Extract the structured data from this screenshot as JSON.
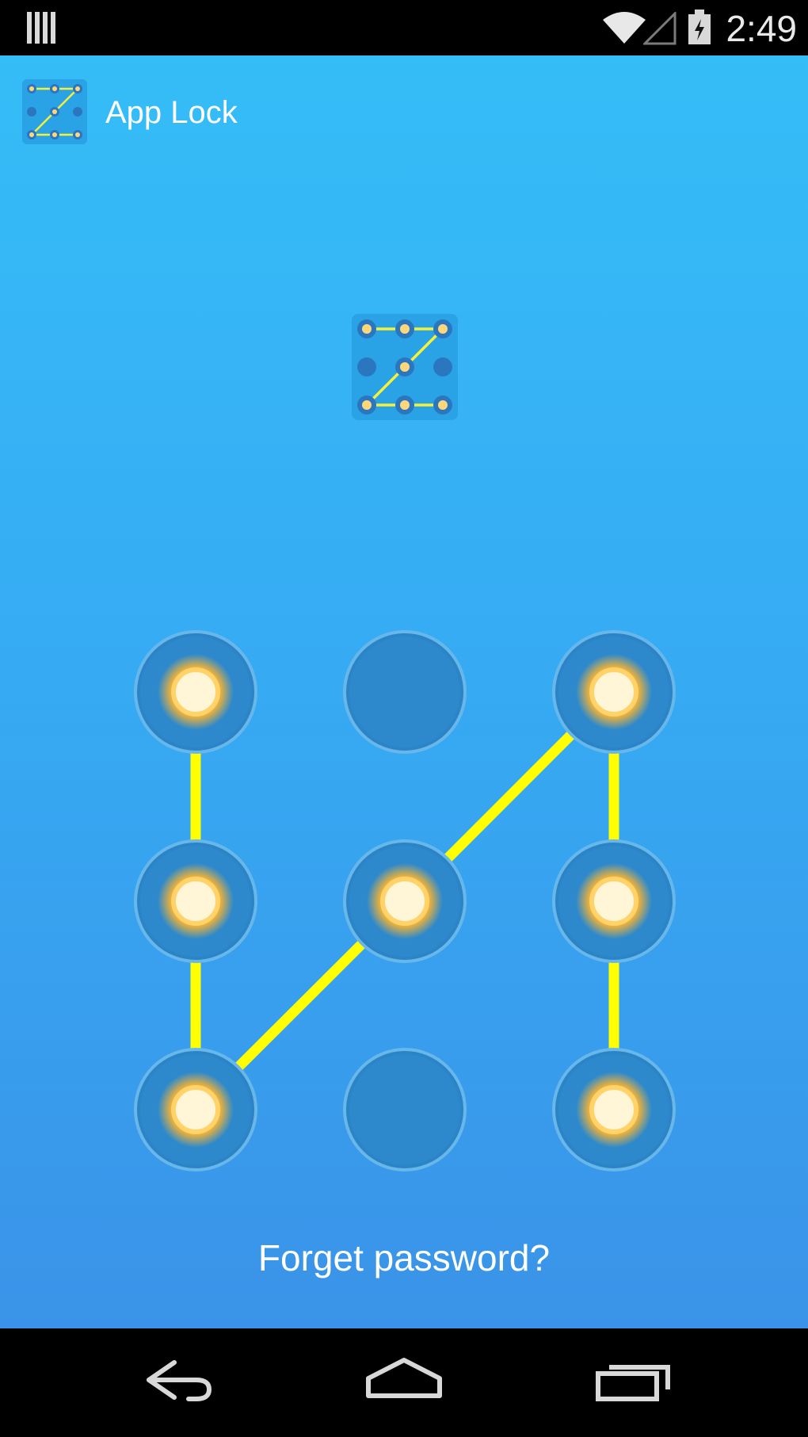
{
  "status_bar": {
    "time": "2:49",
    "icons": [
      "notification-bars-icon",
      "wifi-icon",
      "signal-icon",
      "battery-charging-icon"
    ]
  },
  "app": {
    "title": "App Lock",
    "icon": "pattern-z-icon"
  },
  "pattern": {
    "grid_size": 3,
    "selected_nodes": [
      1,
      4,
      7,
      5,
      3,
      6,
      9
    ],
    "line_color": "#ffff00",
    "node_glow_color": "#ffd36a"
  },
  "forgot_password": {
    "label": "Forget password?"
  },
  "navigation": {
    "buttons": [
      "back-icon",
      "home-icon",
      "recents-icon"
    ]
  },
  "colors": {
    "background_top": "#35bdf7",
    "background_bottom": "#3a93e8",
    "node_ring": "#2b84c6"
  }
}
